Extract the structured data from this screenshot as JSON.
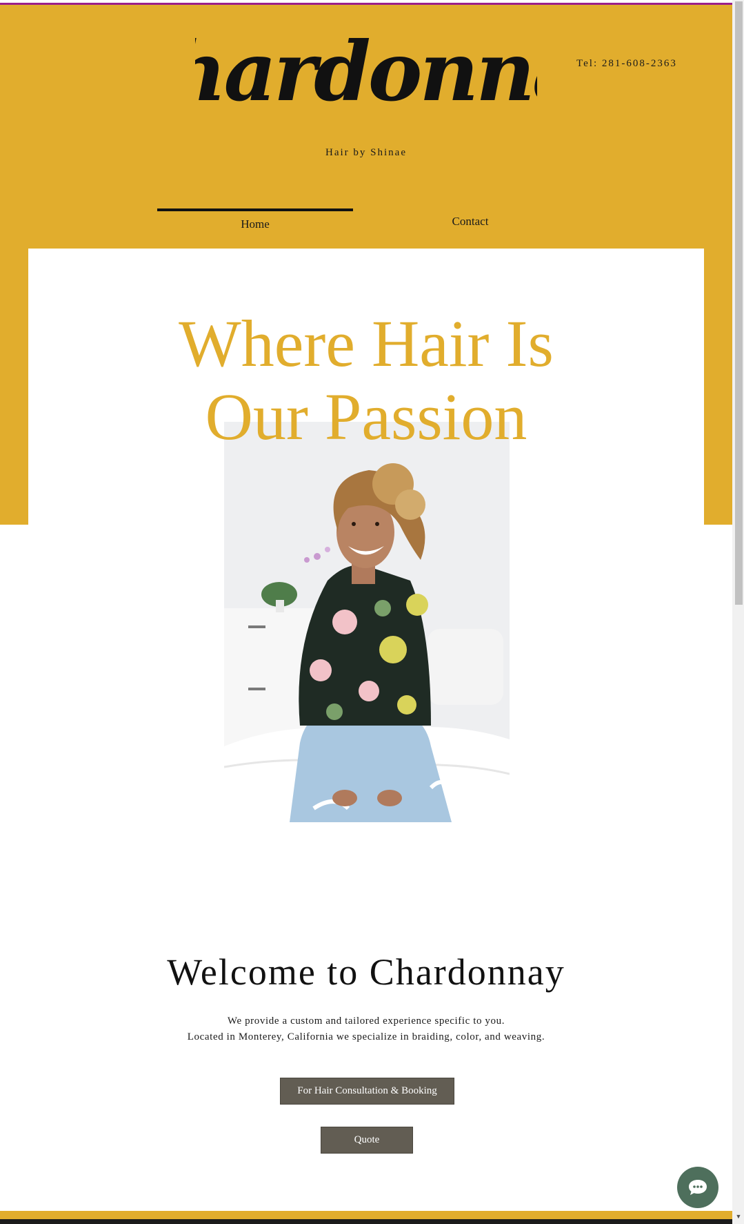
{
  "brand": {
    "logo_text": "Chardonnay",
    "tagline": "Hair by Shinae"
  },
  "contact": {
    "tel": "Tel: 281-608-2363"
  },
  "nav": {
    "items": [
      {
        "label": "Home"
      },
      {
        "label": "Contact"
      }
    ],
    "active": "Home"
  },
  "hero": {
    "line1": "Where Hair Is",
    "line2": "Our Passion"
  },
  "welcome": {
    "title": "Welcome to Chardonnay",
    "line1": "We provide a custom and tailored experience specific to you.",
    "line2": "Located in Monterey, California we specialize in braiding, color, and weaving."
  },
  "buttons": {
    "booking": "For Hair Consultation & Booking",
    "quote": "Quote"
  },
  "colors": {
    "accent": "#e1ad2d",
    "button": "#625d53",
    "chat": "#4e6f5c",
    "top_line": "#9b1f8a"
  },
  "icons": {
    "chat": "chat-bubble-icon"
  }
}
